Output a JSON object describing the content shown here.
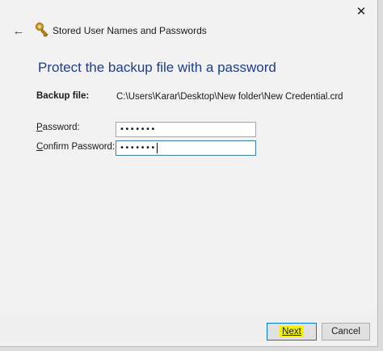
{
  "window": {
    "title": "Stored User Names and Passwords",
    "close_glyph": "✕",
    "back_glyph": "←"
  },
  "page": {
    "heading": "Protect the backup file with a password",
    "backup_label": "Backup file:",
    "backup_path": "C:\\Users\\Karar\\Desktop\\New folder\\New Credential.crd"
  },
  "fields": {
    "password": {
      "label_mnemonic": "P",
      "label_rest": "assword:",
      "value": "•••••••"
    },
    "confirm": {
      "label_mnemonic": "C",
      "label_rest": "onfirm Password:",
      "value": "•••••••"
    }
  },
  "buttons": {
    "next_label": "Next",
    "cancel_label": "Cancel"
  },
  "icons": {
    "close": "close-icon",
    "back": "back-arrow-icon",
    "title": "key-icon"
  },
  "colors": {
    "heading": "#1f3d8c",
    "next_highlight": "#f3f200",
    "default_button_border": "#0078d7"
  }
}
